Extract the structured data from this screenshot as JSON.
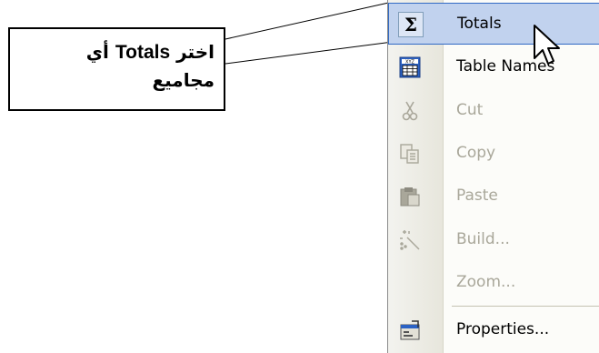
{
  "callout": {
    "line1_ar_before": "اختر ",
    "line1_en": "Totals",
    "line1_ar_after": " أي",
    "line2": "مجاميع"
  },
  "menu": {
    "items": [
      {
        "label": "Totals",
        "icon": "sigma-icon",
        "enabled": true,
        "selected": true
      },
      {
        "label": "Table Names",
        "icon": "table-names-icon",
        "enabled": true,
        "selected": false
      },
      {
        "label": "Cut",
        "icon": "scissors-icon",
        "enabled": false,
        "selected": false
      },
      {
        "label": "Copy",
        "icon": "copy-icon",
        "enabled": false,
        "selected": false
      },
      {
        "label": "Paste",
        "icon": "clipboard-icon",
        "enabled": false,
        "selected": false
      },
      {
        "label": "Build...",
        "icon": "magic-wand-icon",
        "enabled": false,
        "selected": false
      },
      {
        "label": "Zoom...",
        "icon": "",
        "enabled": false,
        "selected": false
      },
      {
        "label": "Properties...",
        "icon": "properties-icon",
        "enabled": true,
        "selected": false
      }
    ]
  },
  "colors": {
    "highlight_fill": "#c1d2ee",
    "highlight_border": "#316ac5",
    "disabled_text": "#a9a79a"
  }
}
